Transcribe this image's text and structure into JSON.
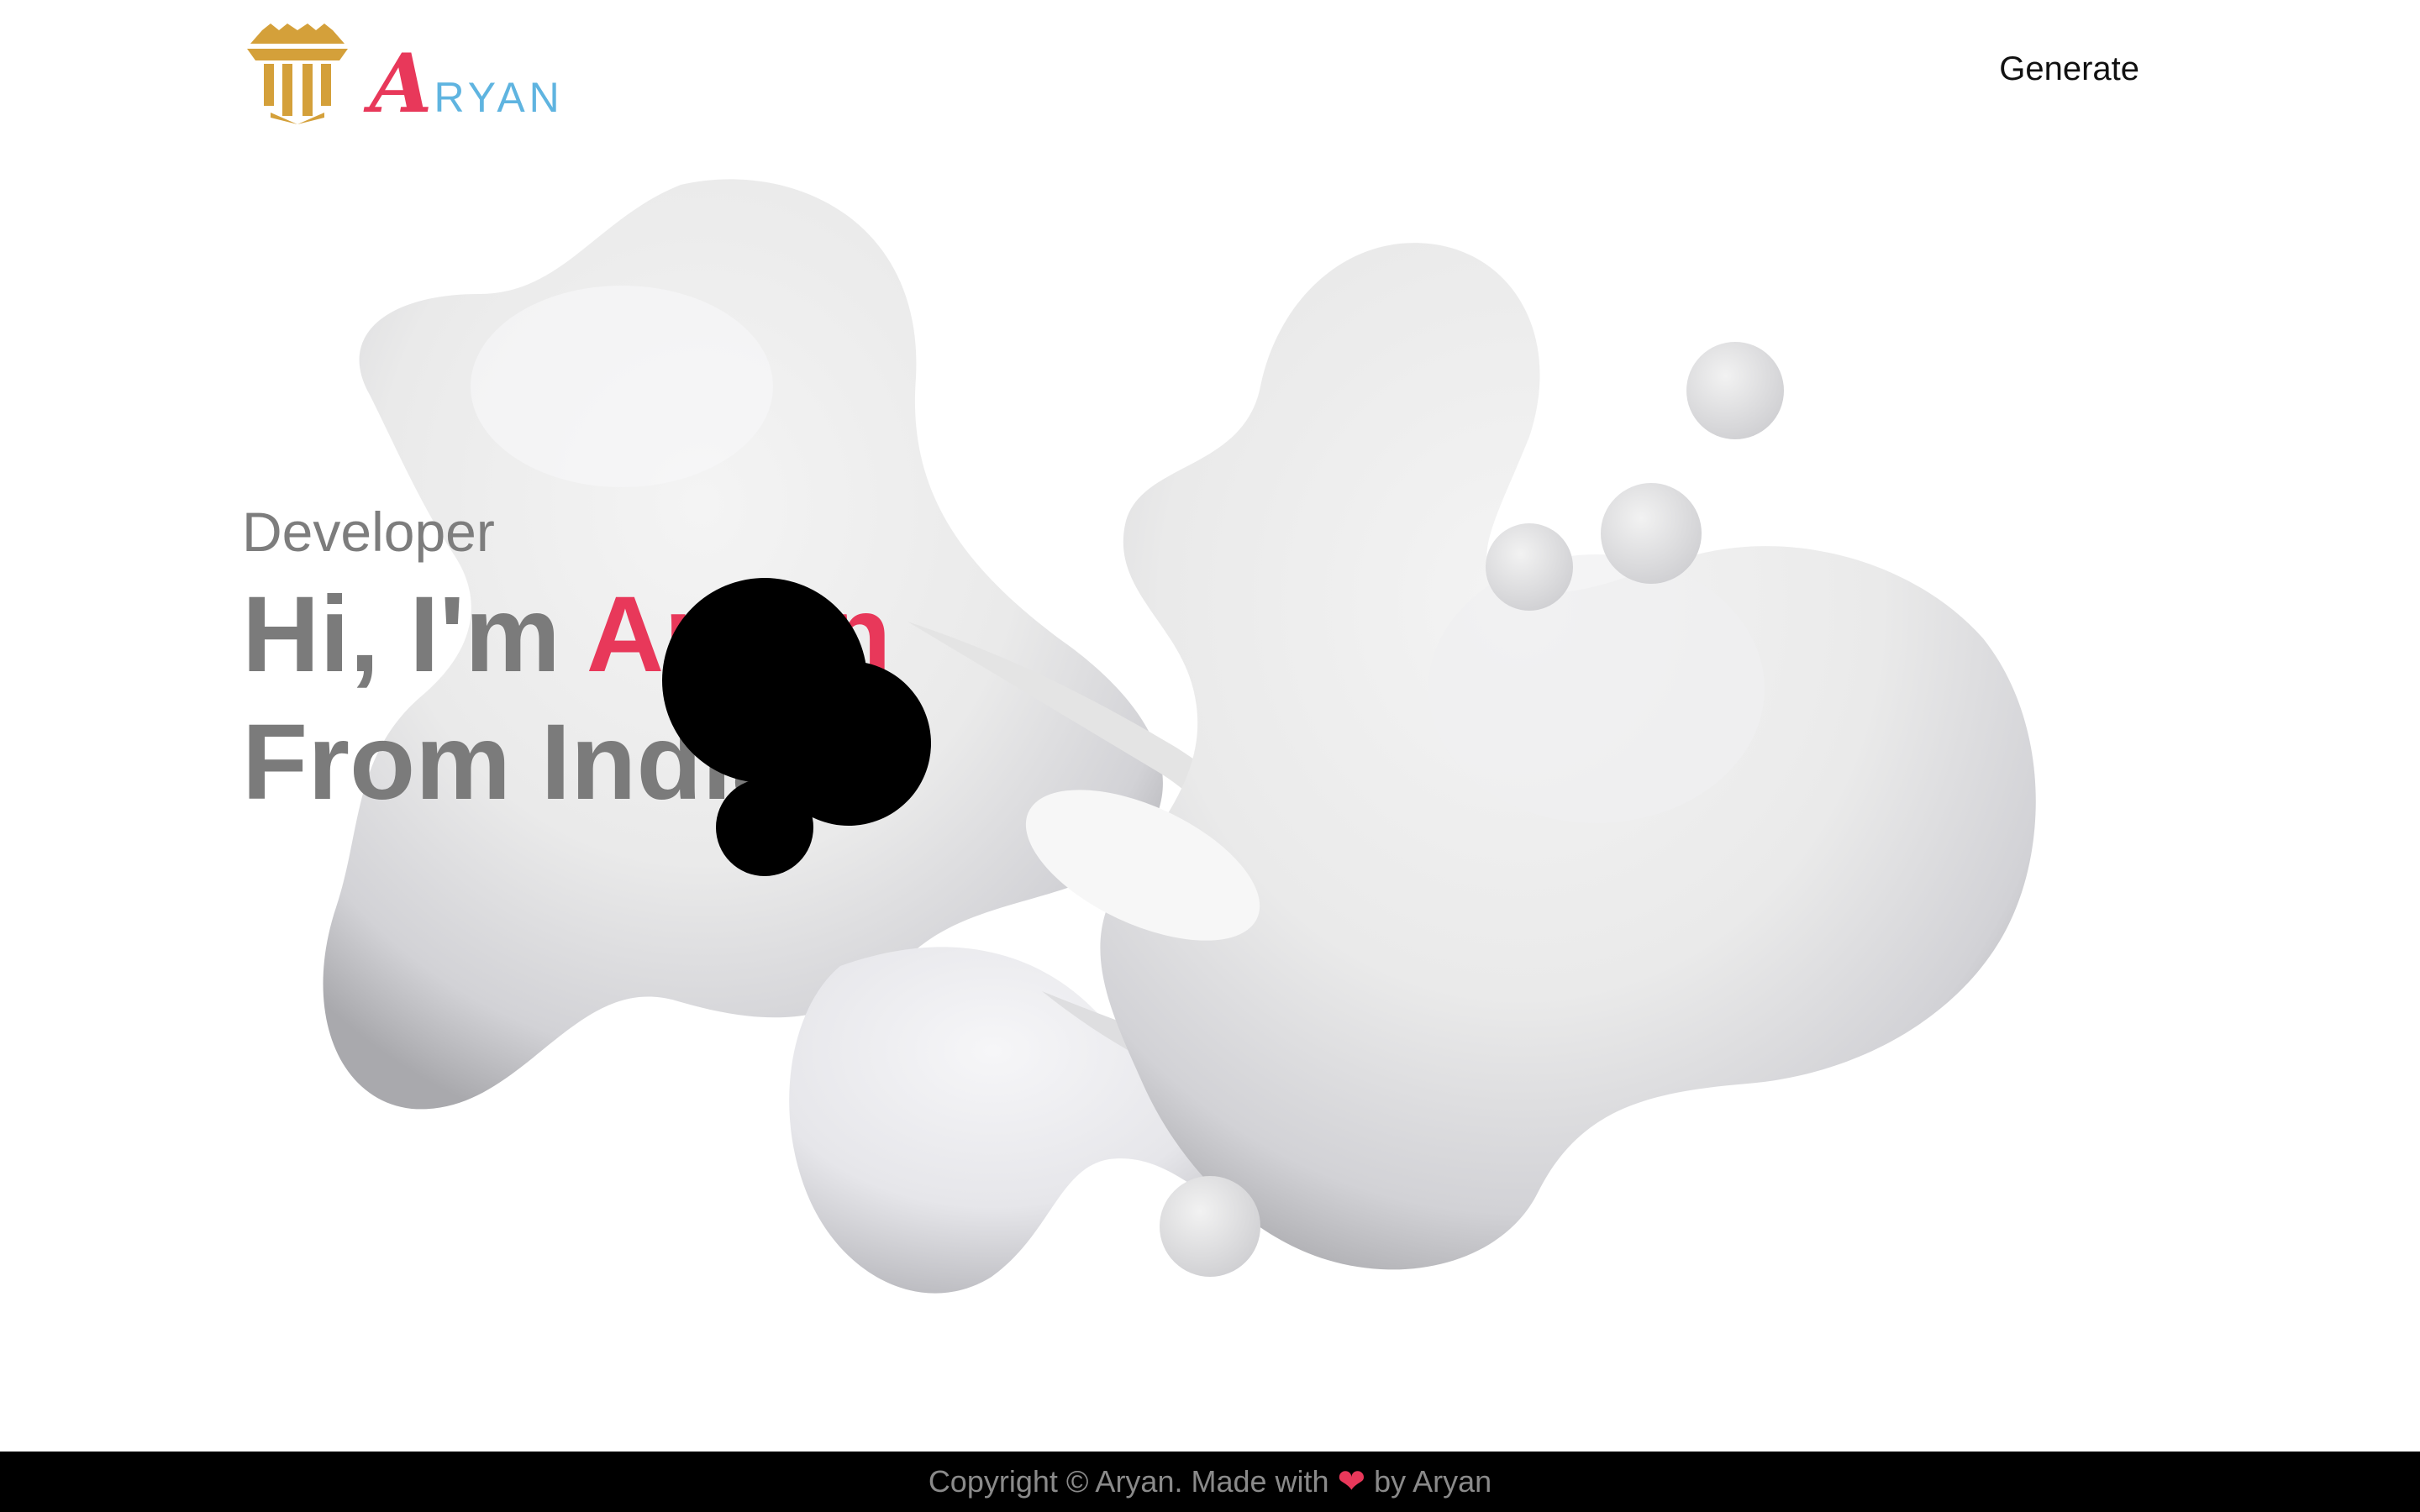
{
  "header": {
    "logo_initial": "A",
    "logo_rest": "RYAN",
    "nav": {
      "generate_label": "Generate"
    }
  },
  "hero": {
    "role": "Developer",
    "greeting": "Hi, I'm",
    "name": "Aryan",
    "location_line": "From India"
  },
  "footer": {
    "copyright_prefix": "Copyright © Aryan. Made with",
    "heart": "❤",
    "suffix": "by Aryan"
  },
  "colors": {
    "accent": "#e8385a",
    "logo_blue": "#5fb4e0",
    "logo_gold": "#d4a03a",
    "hero_text": "#7b7b7b",
    "footer_bg": "#000000"
  },
  "icons": {
    "logo": "crest-icon",
    "footer_heart": "heart-icon"
  }
}
